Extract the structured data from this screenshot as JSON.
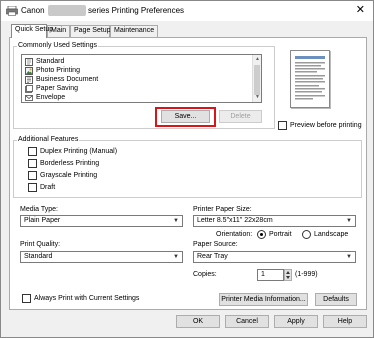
{
  "window": {
    "title_prefix": "Canon",
    "title_suffix": "series Printing Preferences",
    "close_glyph": "✕"
  },
  "tabs": [
    {
      "label": "Quick Setup"
    },
    {
      "label": "Main"
    },
    {
      "label": "Page Setup"
    },
    {
      "label": "Maintenance"
    }
  ],
  "commonly_used": {
    "label": "Commonly Used Settings",
    "items": [
      {
        "label": "Standard",
        "icon": "standard-doc-icon"
      },
      {
        "label": "Photo Printing",
        "icon": "photo-icon"
      },
      {
        "label": "Business Document",
        "icon": "document-icon"
      },
      {
        "label": "Paper Saving",
        "icon": "paper-saving-icon"
      },
      {
        "label": "Envelope",
        "icon": "envelope-icon"
      }
    ],
    "save_label": "Save...",
    "delete_label": "Delete"
  },
  "preview_before_printing": {
    "label": "Preview before printing",
    "checked": false
  },
  "additional_features": {
    "label": "Additional Features",
    "options": [
      {
        "label": "Duplex Printing (Manual)",
        "checked": false
      },
      {
        "label": "Borderless Printing",
        "checked": false
      },
      {
        "label": "Grayscale Printing",
        "checked": false
      },
      {
        "label": "Draft",
        "checked": false
      }
    ]
  },
  "media_type": {
    "label": "Media Type:",
    "value": "Plain Paper"
  },
  "printer_paper_size": {
    "label": "Printer Paper Size:",
    "value": "Letter 8.5\"x11\" 22x28cm"
  },
  "orientation": {
    "label": "Orientation:",
    "portrait_label": "Portrait",
    "landscape_label": "Landscape",
    "selected": "Portrait"
  },
  "print_quality": {
    "label": "Print Quality:",
    "value": "Standard"
  },
  "paper_source": {
    "label": "Paper Source:",
    "value": "Rear Tray"
  },
  "copies": {
    "label": "Copies:",
    "value": "1",
    "range": "(1-999)"
  },
  "always_print": {
    "label": "Always Print with Current Settings",
    "checked": false
  },
  "printer_media_info_label": "Printer Media Information...",
  "defaults_label": "Defaults",
  "footer": {
    "ok_label": "OK",
    "cancel_label": "Cancel",
    "apply_label": "Apply",
    "help_label": "Help"
  }
}
